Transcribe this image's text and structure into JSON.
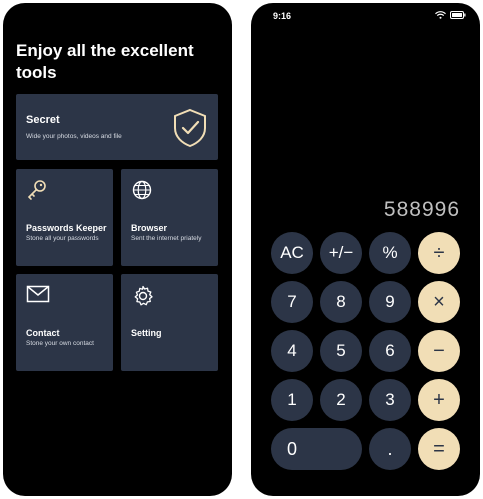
{
  "left_phone": {
    "heading": "Enjoy all the excellent tools",
    "tiles": [
      {
        "title": "Secret",
        "subtitle": "Wide your photos, videos and file",
        "icon": "shield-check-icon"
      },
      {
        "title": "Passwords Keeper",
        "subtitle": "Stone all your passwords",
        "icon": "key-icon"
      },
      {
        "title": "Browser",
        "subtitle": "Sent the internet priately",
        "icon": "globe-icon"
      },
      {
        "title": "Contact",
        "subtitle": "Stone your own contact",
        "icon": "envelope-icon"
      },
      {
        "title": "Setting",
        "subtitle": "",
        "icon": "gear-icon"
      }
    ],
    "colors": {
      "tile_bg": "#2c3547",
      "background": "#000000",
      "text": "#ffffff"
    }
  },
  "right_phone": {
    "status": {
      "time": "9:16"
    },
    "display": "588996",
    "keys": {
      "ac": "AC",
      "plus_minus": "+/−",
      "percent": "%",
      "divide": "÷",
      "seven": "7",
      "eight": "8",
      "nine": "9",
      "multiply": "×",
      "four": "4",
      "five": "5",
      "six": "6",
      "minus": "−",
      "one": "1",
      "two": "2",
      "three": "3",
      "plus": "+",
      "zero": "0",
      "dot": ".",
      "equals": "="
    },
    "colors": {
      "number_key": "#2c3547",
      "operator_key": "#f1deb6",
      "display_text": "#bfbfbf"
    }
  }
}
